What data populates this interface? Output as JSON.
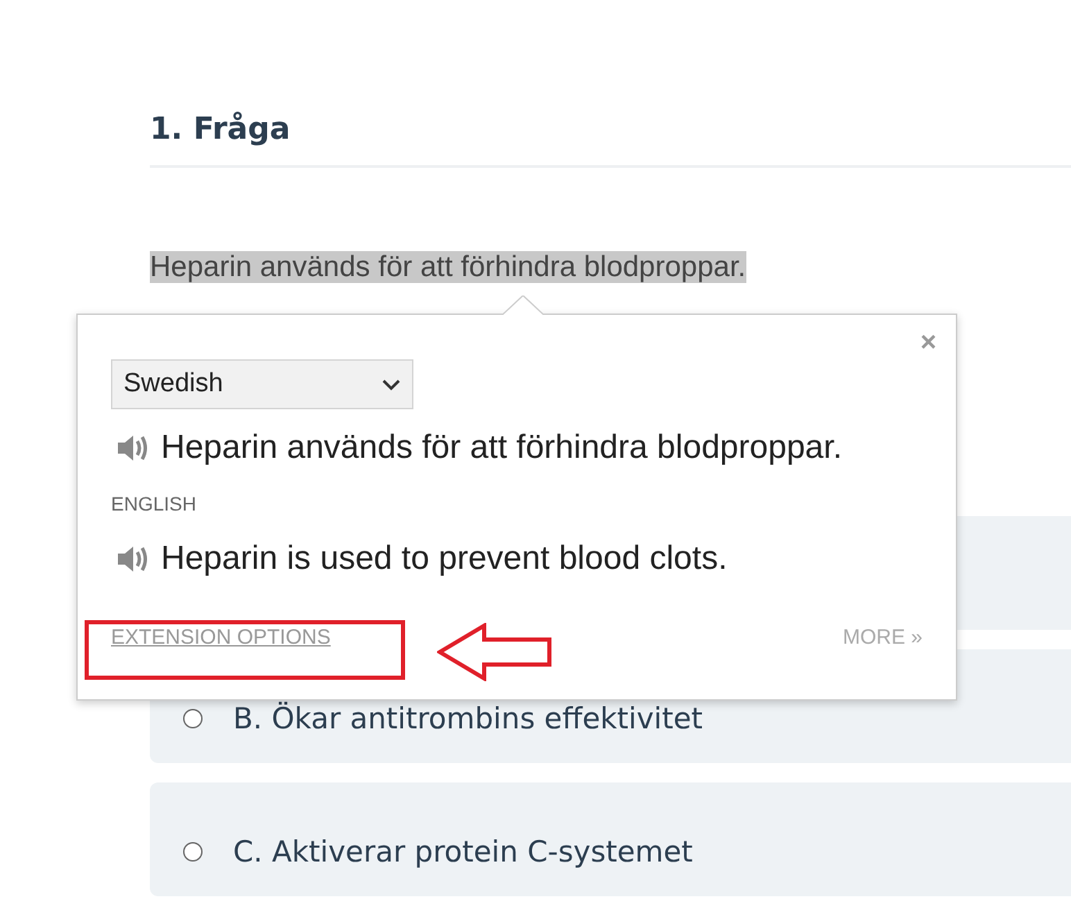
{
  "question": {
    "title": "1. Fråga",
    "text": "Heparin används för att förhindra blodproppar.",
    "highlighted": true
  },
  "options": [
    {
      "label": "B. Ökar antitrombins effektivitet",
      "selected": false
    },
    {
      "label": "C. Aktiverar protein C-systemet",
      "selected": false
    }
  ],
  "popup": {
    "close": "×",
    "language": "Swedish",
    "source_text": "Heparin används för att förhindra blodproppar.",
    "target_language": "ENGLISH",
    "translation": "Heparin is used to prevent blood clots.",
    "options_link": "EXTENSION OPTIONS",
    "more_link": "MORE »"
  }
}
